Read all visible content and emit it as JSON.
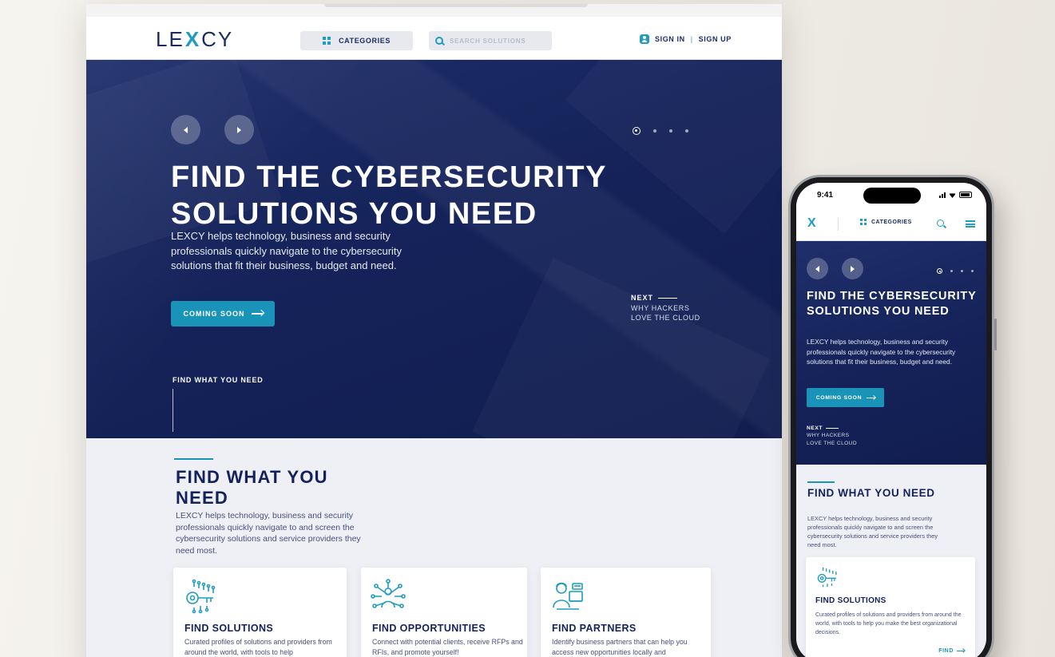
{
  "brand": {
    "name_left": "LE",
    "name_mark": "X",
    "name_right": "CY",
    "accent_color": "#1f9cc0",
    "navy_color": "#13225c"
  },
  "header": {
    "categories_label": "CATEGORIES",
    "search_placeholder": "SEARCH SOLUTIONS",
    "sign_in": "SIGN IN",
    "separator": "|",
    "sign_up": "SIGN UP"
  },
  "hero": {
    "title": "FIND THE CYBERSECURITY SOLUTIONS YOU NEED",
    "description": "LEXCY helps technology, business and security professionals quickly navigate to the cybersecurity solutions that fit their business, budget and need.",
    "cta_label": "COMING SOON",
    "slide_count": 4,
    "active_slide": 1,
    "next_label": "NEXT",
    "next_title_line1": "WHY HACKERS",
    "next_title_line2": "LOVE THE CLOUD",
    "scroll_label": "FIND WHAT YOU NEED"
  },
  "section": {
    "title": "FIND WHAT YOU NEED",
    "description": "LEXCY helps technology, business and security professionals quickly navigate to and screen the cybersecurity solutions and service providers they need most.",
    "cards": [
      {
        "icon": "circuit-key-icon",
        "title": "FIND SOLUTIONS",
        "text": "Curated profiles of solutions and providers from around the world, with tools to help"
      },
      {
        "icon": "network-person-icon",
        "title": "FIND OPPORTUNITIES",
        "text": "Connect with potential clients, receive RFPs and RFIs, and promote yourself!"
      },
      {
        "icon": "partner-chat-icon",
        "title": "FIND PARTNERS",
        "text": "Identify business partners that can help you access new opportunities locally and"
      }
    ]
  },
  "phone": {
    "time": "9:41",
    "logo_mark": "X",
    "categories_label": "CATEGORIES",
    "hero_title": "FIND THE CYBERSECURITY SOLUTIONS YOU NEED",
    "hero_description": "LEXCY helps technology, business and security professionals quickly navigate to the cybersecurity solutions that fit their business, budget and need.",
    "cta_label": "COMING SOON",
    "next_label": "NEXT",
    "next_title_line1": "WHY HACKERS",
    "next_title_line2": "LOVE THE CLOUD",
    "section_title": "FIND WHAT YOU NEED",
    "section_description": "LEXCY helps technology, business and security professionals quickly navigate to and screen the cybersecurity solutions and service providers they need most.",
    "card_title": "FIND SOLUTIONS",
    "card_text": "Curated profiles of solutions and providers from around the world, with tools to help you make the best organizational decisions.",
    "card_link": "FIND"
  }
}
